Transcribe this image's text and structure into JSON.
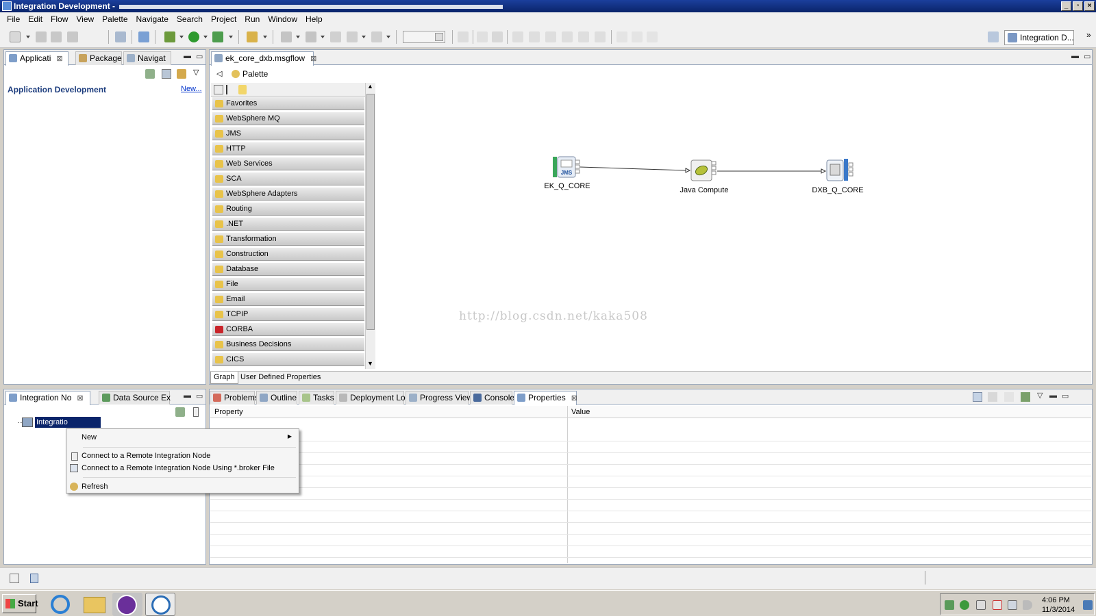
{
  "window": {
    "title": "Integration Development -",
    "controls": [
      "minimize-icon",
      "restore-icon",
      "close-icon"
    ]
  },
  "menu": [
    "File",
    "Edit",
    "Flow",
    "View",
    "Palette",
    "Navigate",
    "Search",
    "Project",
    "Run",
    "Window",
    "Help"
  ],
  "perspective": {
    "label": "Integration D..."
  },
  "left_top": {
    "tabs": [
      {
        "label": "Applicati",
        "active": true
      },
      {
        "label": "Package"
      },
      {
        "label": "Navigat"
      }
    ],
    "heading": "Application Development",
    "new_link": "New..."
  },
  "editor": {
    "tab_label": "ek_core_dxb.msgflow",
    "palette_label": "Palette",
    "palette_items": [
      "Favorites",
      "WebSphere MQ",
      "JMS",
      "HTTP",
      "Web Services",
      "SCA",
      "WebSphere Adapters",
      "Routing",
      ".NET",
      "Transformation",
      "Construction",
      "Database",
      "File",
      "Email",
      "TCPIP",
      "CORBA",
      "Business Decisions",
      "CICS"
    ],
    "nodes": [
      {
        "name": "EK_Q_CORE",
        "icon": "jms-input-icon"
      },
      {
        "name": "Java Compute",
        "icon": "java-compute-icon"
      },
      {
        "name": "DXB_Q_CORE",
        "icon": "output-queue-icon"
      }
    ],
    "bottom_tabs": [
      "Graph",
      "User Defined Properties"
    ],
    "watermark": "http://blog.csdn.net/kaka508"
  },
  "left_bottom": {
    "tabs": [
      {
        "label": "Integration No",
        "active": true
      },
      {
        "label": "Data Source Ex"
      }
    ],
    "tree_item": "Integratio"
  },
  "context_menu": {
    "new": "New",
    "connect": "Connect to a Remote Integration Node",
    "connect_broker": "Connect to a Remote Integration Node Using *.broker File",
    "refresh": "Refresh"
  },
  "bottom_panel": {
    "tabs": [
      "Problems",
      "Outline",
      "Tasks",
      "Deployment Log",
      "Progress View",
      "Console",
      "Properties"
    ],
    "columns": [
      "Property",
      "Value"
    ]
  },
  "taskbar": {
    "start": "Start",
    "time": "4:06 PM",
    "date": "11/3/2014"
  },
  "colors": {
    "selection": "#0a246a",
    "titlebar": "#0a246a"
  }
}
